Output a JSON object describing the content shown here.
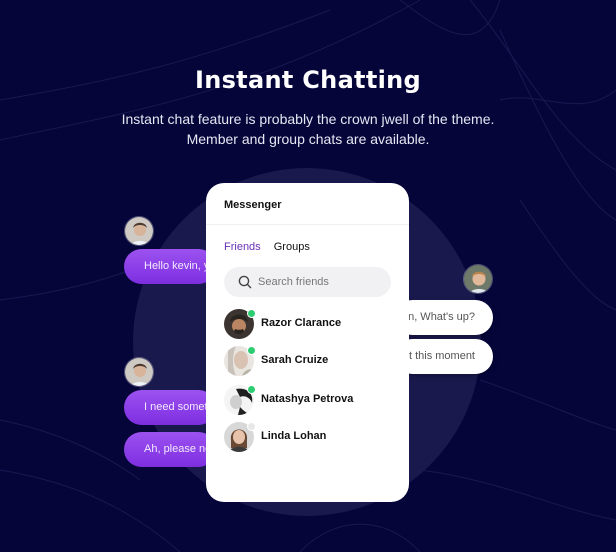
{
  "header": {
    "title": "Instant Chatting",
    "subtitle_line1": "Instant chat feature is probably the crown jwell of the theme.",
    "subtitle_line2": "Member and group chats are available."
  },
  "colors": {
    "background": "#05053a",
    "accent_purple": "#8a3ce8",
    "active_tab": "#6a2fb8",
    "online_dot": "#2ecc71"
  },
  "left_chat": {
    "messages": [
      {
        "text": "Hello kevin, y"
      },
      {
        "text": "I need somet"
      },
      {
        "text": "Ah, please ne"
      }
    ]
  },
  "right_chat": {
    "messages": [
      {
        "text": "n, What's up?"
      },
      {
        "text": "t this moment"
      }
    ]
  },
  "messenger": {
    "title": "Messenger",
    "tabs": [
      {
        "label": "Friends",
        "active": true
      },
      {
        "label": "Groups",
        "active": false
      }
    ],
    "search": {
      "placeholder": "Search friends",
      "value": "",
      "icon": "search-icon"
    },
    "friends": [
      {
        "name": "Razor Clarance",
        "status": "online"
      },
      {
        "name": "Sarah Cruize",
        "status": "online"
      },
      {
        "name": "Natashya Petrova",
        "status": "online"
      },
      {
        "name": "Linda Lohan",
        "status": "offline"
      }
    ]
  }
}
